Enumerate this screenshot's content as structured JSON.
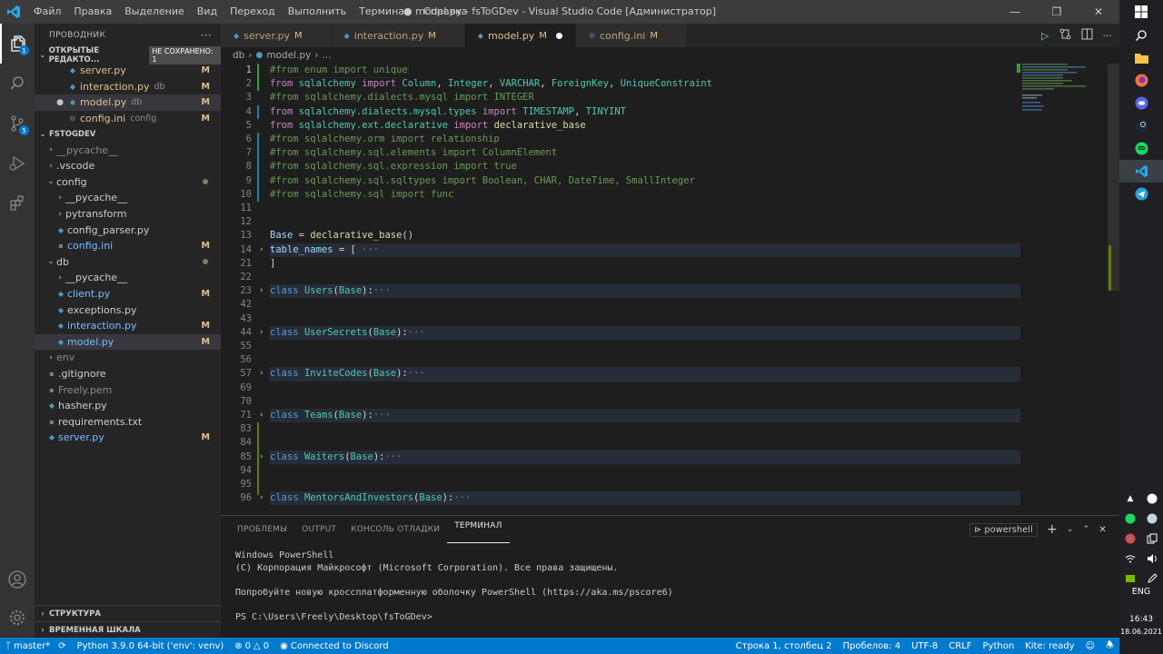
{
  "window": {
    "title": "● model.py - fsToGDev - Visual Studio Code [Администратор]",
    "menu": [
      "Файл",
      "Правка",
      "Выделение",
      "Вид",
      "Переход",
      "Выполнить",
      "Терминал",
      "Справка"
    ]
  },
  "activity": {
    "explorer_badge": "1",
    "scm_badge": "5"
  },
  "sidebar": {
    "title": "ПРОВОДНИК",
    "more": "···",
    "open_editors": {
      "header": "ОТКРЫТЫЕ РЕДАКТО...",
      "unsaved": "НЕ СОХРАНЕНО: 1",
      "items": [
        {
          "name": "server.py",
          "desc": "",
          "mark": "M"
        },
        {
          "name": "interaction.py",
          "desc": "db",
          "mark": "M"
        },
        {
          "name": "model.py",
          "desc": "db",
          "mark": "M"
        },
        {
          "name": "config.ini",
          "desc": "config",
          "mark": "M"
        }
      ]
    },
    "workspace": {
      "header": "FSTOGDEV",
      "tree": [
        {
          "name": "__pycache__",
          "depth": 0,
          "kind": "folder-closed",
          "dim": true
        },
        {
          "name": ".vscode",
          "depth": 0,
          "kind": "folder-closed"
        },
        {
          "name": "config",
          "depth": 0,
          "kind": "folder-open",
          "status": "dot",
          "mod": true
        },
        {
          "name": "__pycache__",
          "depth": 1,
          "kind": "folder-closed"
        },
        {
          "name": "pytransform",
          "depth": 1,
          "kind": "folder-closed"
        },
        {
          "name": "config_parser.py",
          "depth": 1,
          "kind": "file"
        },
        {
          "name": "config.ini",
          "depth": 1,
          "kind": "file",
          "status": "M",
          "mod": true
        },
        {
          "name": "db",
          "depth": 0,
          "kind": "folder-open",
          "status": "dot",
          "mod": true
        },
        {
          "name": "__pycache__",
          "depth": 1,
          "kind": "folder-closed"
        },
        {
          "name": "client.py",
          "depth": 1,
          "kind": "file",
          "status": "M",
          "mod": true
        },
        {
          "name": "exceptions.py",
          "depth": 1,
          "kind": "file"
        },
        {
          "name": "interaction.py",
          "depth": 1,
          "kind": "file",
          "status": "M",
          "mod": true
        },
        {
          "name": "model.py",
          "depth": 1,
          "kind": "file",
          "status": "M",
          "mod": true,
          "selected": true
        },
        {
          "name": "env",
          "depth": 0,
          "kind": "folder-closed",
          "dim": true
        },
        {
          "name": ".gitignore",
          "depth": 0,
          "kind": "file"
        },
        {
          "name": "Freely.pem",
          "depth": 0,
          "kind": "file",
          "dim": true
        },
        {
          "name": "hasher.py",
          "depth": 0,
          "kind": "file"
        },
        {
          "name": "requirements.txt",
          "depth": 0,
          "kind": "file"
        },
        {
          "name": "server.py",
          "depth": 0,
          "kind": "file",
          "status": "M",
          "mod": true
        }
      ]
    },
    "outline": "СТРУКТУРА",
    "timeline": "ВРЕМЕННАЯ ШКАЛА"
  },
  "tabs": [
    {
      "name": "server.py",
      "mark": "M",
      "active": false
    },
    {
      "name": "interaction.py",
      "mark": "M",
      "active": false
    },
    {
      "name": "model.py",
      "mark": "M",
      "active": true,
      "dirty": true
    },
    {
      "name": "config.ini",
      "mark": "M",
      "active": false
    }
  ],
  "breadcrumb": [
    "db",
    "model.py",
    "..."
  ],
  "editor": {
    "lines": [
      {
        "n": "1",
        "cur": true,
        "tokens": [
          [
            "c-com",
            "#from enum import unique"
          ]
        ]
      },
      {
        "n": "2",
        "tokens": [
          [
            "c-kw2",
            "from "
          ],
          [
            "c-mod",
            "sqlalchemy"
          ],
          [
            "c-kw2",
            " import "
          ],
          [
            "c-cls",
            "Column"
          ],
          [
            "c-txt",
            ", "
          ],
          [
            "c-cls",
            "Integer"
          ],
          [
            "c-txt",
            ", "
          ],
          [
            "c-cls",
            "VARCHAR"
          ],
          [
            "c-txt",
            ", "
          ],
          [
            "c-cls",
            "ForeignKey"
          ],
          [
            "c-txt",
            ", "
          ],
          [
            "c-cls",
            "UniqueConstraint"
          ]
        ]
      },
      {
        "n": "3",
        "tokens": [
          [
            "c-com",
            "#from sqlalchemy.dialects.mysql import INTEGER"
          ]
        ]
      },
      {
        "n": "4",
        "tokens": [
          [
            "c-kw2",
            "from "
          ],
          [
            "c-mod",
            "sqlalchemy.dialects.mysql.types"
          ],
          [
            "c-kw2",
            " import "
          ],
          [
            "c-cls",
            "TIMESTAMP"
          ],
          [
            "c-txt",
            ", "
          ],
          [
            "c-cls",
            "TINYINT"
          ]
        ]
      },
      {
        "n": "5",
        "tokens": [
          [
            "c-kw2",
            "from "
          ],
          [
            "c-mod",
            "sqlalchemy.ext.declarative"
          ],
          [
            "c-kw2",
            " import "
          ],
          [
            "c-fn",
            "declarative_base"
          ]
        ]
      },
      {
        "n": "6",
        "tokens": [
          [
            "c-com",
            "#from sqlalchemy.orm import relationship"
          ]
        ]
      },
      {
        "n": "7",
        "tokens": [
          [
            "c-com",
            "#from sqlalchemy.sql.elements import ColumnElement"
          ]
        ]
      },
      {
        "n": "8",
        "tokens": [
          [
            "c-com",
            "#from sqlalchemy.sql.expression import true"
          ]
        ]
      },
      {
        "n": "9",
        "tokens": [
          [
            "c-com",
            "#from sqlalchemy.sql.sqltypes import Boolean, CHAR, DateTime, SmallInteger"
          ]
        ]
      },
      {
        "n": "10",
        "tokens": [
          [
            "c-com",
            "#from sqlalchemy.sql import func"
          ]
        ]
      },
      {
        "n": "11",
        "tokens": []
      },
      {
        "n": "12",
        "tokens": []
      },
      {
        "n": "13",
        "tokens": [
          [
            "c-var",
            "Base"
          ],
          [
            "c-txt",
            " = "
          ],
          [
            "c-fn",
            "declarative_base"
          ],
          [
            "c-txt",
            "()"
          ]
        ]
      },
      {
        "n": "14",
        "fold": true,
        "hl": true,
        "tokens": [
          [
            "c-var",
            "table_names"
          ],
          [
            "c-txt",
            " = ["
          ],
          [
            "ellipsis",
            " ···"
          ]
        ]
      },
      {
        "n": "21",
        "tokens": [
          [
            "c-txt",
            "]"
          ]
        ]
      },
      {
        "n": "22",
        "tokens": []
      },
      {
        "n": "23",
        "fold": true,
        "hl": true,
        "tokens": [
          [
            "c-kw",
            "class "
          ],
          [
            "c-cls",
            "Users"
          ],
          [
            "c-txt",
            "("
          ],
          [
            "c-cls",
            "Base"
          ],
          [
            "c-txt",
            "):"
          ],
          [
            "ellipsis",
            "···"
          ]
        ]
      },
      {
        "n": "42",
        "tokens": []
      },
      {
        "n": "43",
        "tokens": []
      },
      {
        "n": "44",
        "fold": true,
        "hl": true,
        "tokens": [
          [
            "c-kw",
            "class "
          ],
          [
            "c-cls",
            "UserSecrets"
          ],
          [
            "c-txt",
            "("
          ],
          [
            "c-cls",
            "Base"
          ],
          [
            "c-txt",
            "):"
          ],
          [
            "ellipsis",
            "···"
          ]
        ]
      },
      {
        "n": "55",
        "tokens": []
      },
      {
        "n": "56",
        "tokens": []
      },
      {
        "n": "57",
        "fold": true,
        "hl": true,
        "tokens": [
          [
            "c-kw",
            "class "
          ],
          [
            "c-cls",
            "InviteCodes"
          ],
          [
            "c-txt",
            "("
          ],
          [
            "c-cls",
            "Base"
          ],
          [
            "c-txt",
            "):"
          ],
          [
            "ellipsis",
            "···"
          ]
        ]
      },
      {
        "n": "69",
        "tokens": []
      },
      {
        "n": "70",
        "tokens": []
      },
      {
        "n": "71",
        "fold": true,
        "hl": true,
        "tokens": [
          [
            "c-kw",
            "class "
          ],
          [
            "c-cls",
            "Teams"
          ],
          [
            "c-txt",
            "("
          ],
          [
            "c-cls",
            "Base"
          ],
          [
            "c-txt",
            "):"
          ],
          [
            "ellipsis",
            "···"
          ]
        ]
      },
      {
        "n": "83",
        "tokens": []
      },
      {
        "n": "84",
        "tokens": []
      },
      {
        "n": "85",
        "fold": true,
        "hl": true,
        "tokens": [
          [
            "c-kw",
            "class "
          ],
          [
            "c-cls",
            "Waiters"
          ],
          [
            "c-txt",
            "("
          ],
          [
            "c-cls",
            "Base"
          ],
          [
            "c-txt",
            "):"
          ],
          [
            "ellipsis",
            "···"
          ]
        ]
      },
      {
        "n": "94",
        "tokens": []
      },
      {
        "n": "95",
        "tokens": []
      },
      {
        "n": "96",
        "fold": true,
        "hl": true,
        "tokens": [
          [
            "c-kw",
            "class "
          ],
          [
            "c-cls",
            "MentorsAndInvestors"
          ],
          [
            "c-txt",
            "("
          ],
          [
            "c-cls",
            "Base"
          ],
          [
            "c-txt",
            "):"
          ],
          [
            "ellipsis",
            "···"
          ]
        ]
      }
    ]
  },
  "panel": {
    "tabs": [
      "ПРОБЛЕМЫ",
      "OUTPUT",
      "КОНСОЛЬ ОТЛАДКИ",
      "ТЕРМИНАЛ"
    ],
    "active_tab": "ТЕРМИНАЛ",
    "shell": "powershell",
    "terminal_lines": [
      "Windows PowerShell",
      "(C) Корпорация Майкрософт (Microsoft Corporation). Все права защищены.",
      "",
      "Попробуйте новую кроссплатформенную оболочку PowerShell (https://aka.ms/pscore6)",
      "",
      "PS C:\\Users\\Freely\\Desktop\\fsToGDev>"
    ]
  },
  "status": {
    "branch": "master*",
    "python": "Python 3.9.0 64-bit ('env': venv)",
    "errors": "0",
    "warnings": "0",
    "discord": "Connected to Discord",
    "position": "Строка 1, столбец 2",
    "spaces": "Пробелов: 4",
    "encoding": "UTF-8",
    "eol": "CRLF",
    "language": "Python",
    "kite": "Kite: ready"
  },
  "taskbar": {
    "lang": "ENG",
    "time": "16:43",
    "date": "18.06.2021"
  }
}
